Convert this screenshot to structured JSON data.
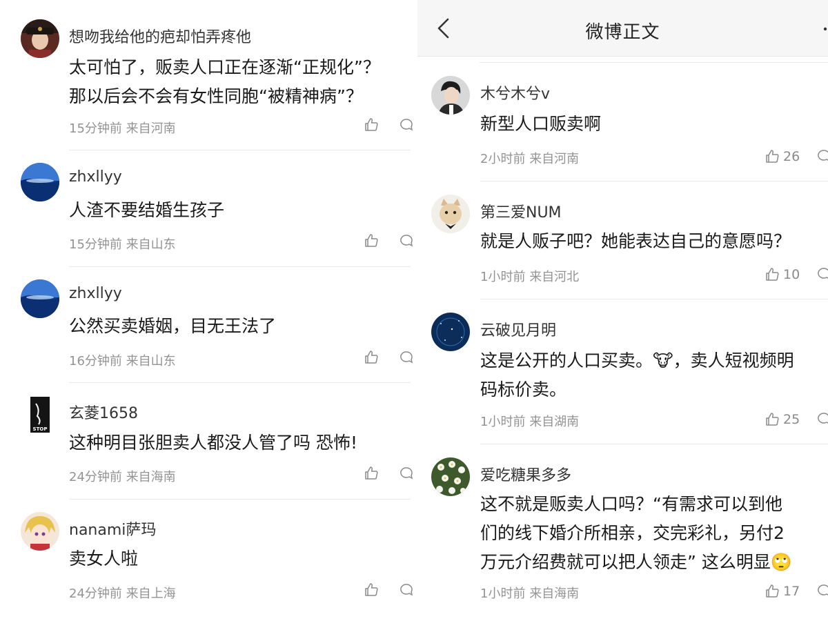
{
  "left": {
    "comments": [
      {
        "user": "想吻我给他的疤却怕弄疼他",
        "text": "太可怕了，贩卖人口正在逐渐“正规化”？\n那以后会不会有女性同胞“被精神病”？",
        "time": "15分钟前",
        "location": "来自河南",
        "avatar": "portrait-avatar"
      },
      {
        "user": "zhxllyy",
        "text": "人渣不要结婚生孩子",
        "time": "15分钟前",
        "location": "来自山东",
        "avatar": "ocean-avatar"
      },
      {
        "user": "zhxllyy",
        "text": "公然买卖婚姻，目无王法了",
        "time": "16分钟前",
        "location": "来自山东",
        "avatar": "ocean-avatar"
      },
      {
        "user": "玄菱1658",
        "text": "这种明目张胆卖人都没人管了吗 恐怖!",
        "time": "24分钟前",
        "location": "来自海南",
        "avatar": "stop-sign-avatar",
        "avatar_label": "STOP"
      },
      {
        "user": "nanami萨玛",
        "text": "卖女人啦",
        "time": "24分钟前",
        "location": "来自上海",
        "avatar": "anime-avatar"
      }
    ]
  },
  "right": {
    "header": {
      "title": "微博正文",
      "back_icon": "chevron-left-icon",
      "more_icon": "more-icon"
    },
    "comments": [
      {
        "user": "木兮木兮v",
        "text": "新型人口贩卖啊",
        "time": "2小时前",
        "location": "来自河南",
        "likes": "26",
        "avatar": "man-avatar"
      },
      {
        "user": "第三爱NUM",
        "text": "就是人贩子吧？她能表达自己的意愿吗？",
        "time": "1小时前",
        "location": "来自河北",
        "likes": "10",
        "avatar": "cat-avatar"
      },
      {
        "user": "云破见月明",
        "text": "这是公开的人口买卖。🐮，卖人短视频明\n码标价卖。",
        "time": "1小时前",
        "location": "来自湖南",
        "likes": "25",
        "avatar": "night-sky-avatar"
      },
      {
        "user": "爱吃糖果多多",
        "text": "这不就是贩卖人口吗？“有需求可以到他\n们的线下婚介所相亲，交完彩礼，另付2\n万元介绍费就可以把人领走” 这么明显🙄",
        "time": "1小时前",
        "location": "来自海南",
        "likes": "17",
        "avatar": "flowers-avatar"
      }
    ]
  },
  "colors": {
    "meta_text": "#939393",
    "body_text": "#1a1a1a",
    "header_bg": "#f6f6f6"
  }
}
